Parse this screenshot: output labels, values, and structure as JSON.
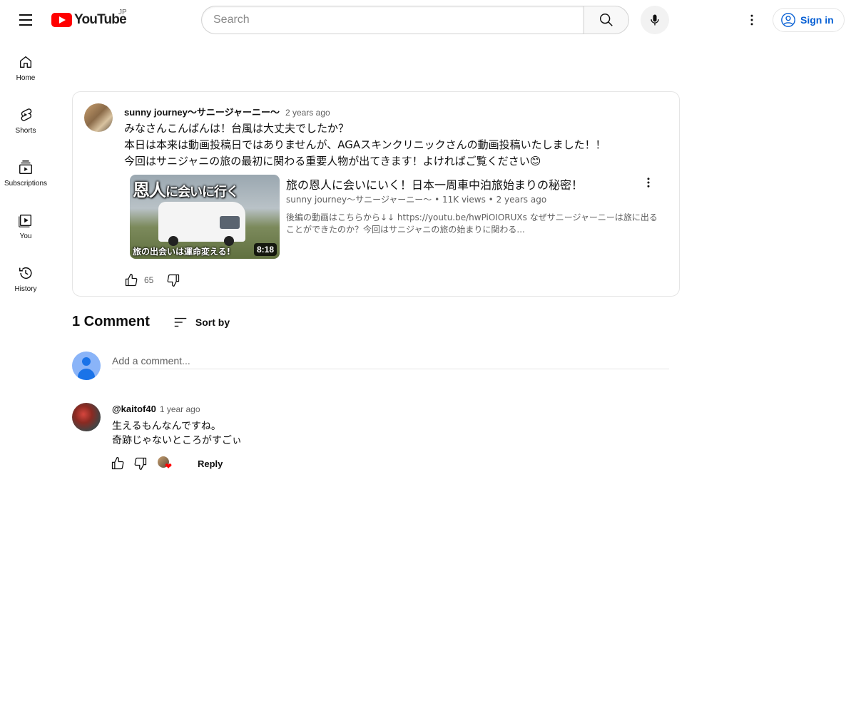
{
  "header": {
    "logo_text": "YouTube",
    "country_code": "JP",
    "search_placeholder": "Search",
    "signin_label": "Sign in"
  },
  "sidebar": {
    "items": [
      {
        "label": "Home",
        "icon": "home-icon"
      },
      {
        "label": "Shorts",
        "icon": "shorts-icon"
      },
      {
        "label": "Subscriptions",
        "icon": "subscriptions-icon"
      },
      {
        "label": "You",
        "icon": "you-icon"
      },
      {
        "label": "History",
        "icon": "history-icon"
      }
    ]
  },
  "post": {
    "author": "sunny journey〜サニージャーニー〜",
    "time": "2 years ago",
    "text_lines": [
      "みなさんこんばんは！台風は大丈夫でしたか？",
      "本日は本来は動画投稿日ではありませんが、AGAスキンクリニックさんの動画投稿いたしました！！",
      "今回はサニジャニの旅の最初に関わる重要人物が出てきます！よければご覧ください😊"
    ],
    "video": {
      "thumb_title_big": "恩人",
      "thumb_title_small": "に会いに行く",
      "thumb_caption": "旅の出会いは運命変える!",
      "duration": "8:18",
      "title": "旅の恩人に会いにいく！日本一周車中泊旅始まりの秘密！",
      "channel": "sunny journey〜サニージャーニー〜",
      "views": "11K views",
      "age": "2 years ago",
      "description": "後編の動画はこちらから↓↓ https://youtu.be/hwPiOIORUXs なぜサニージャーニーは旅に出ることができたのか？今回はサニジャニの旅の始まりに関わる..."
    },
    "like_count": "65"
  },
  "comments": {
    "count_label": "1 Comment",
    "sort_label": "Sort by",
    "add_placeholder": "Add a comment...",
    "items": [
      {
        "author": "@kaitof40",
        "time": "1 year ago",
        "text_lines": [
          "生えるもんなんですね。",
          "奇跡じゃないところがすごぃ"
        ],
        "reply_label": "Reply",
        "hearted_by_creator": true
      }
    ]
  },
  "colors": {
    "brand_red": "#ff0000",
    "link_blue": "#065fd4",
    "text_primary": "#0f0f0f",
    "text_secondary": "#606060"
  }
}
